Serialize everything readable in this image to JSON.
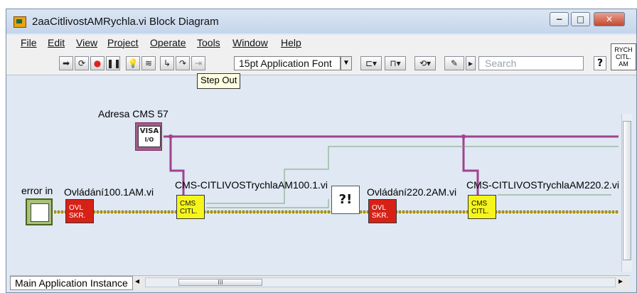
{
  "window": {
    "title": "2aaCitlivostAMRychla.vi Block Diagram",
    "controls": {
      "minimize": "−",
      "maximize": "□",
      "close": "✕"
    }
  },
  "menu": [
    "File",
    "Edit",
    "View",
    "Project",
    "Operate",
    "Tools",
    "Window",
    "Help"
  ],
  "toolbar": {
    "font_select": "15pt Application Font",
    "search_placeholder": "Search",
    "help_label": "?",
    "tooltip": "Step Out",
    "icons": [
      "run-arrow-icon",
      "run-continuously-icon",
      "abort-icon",
      "pause-icon",
      "highlight-execution-icon",
      "retain-wire-values-icon",
      "step-into-icon",
      "step-over-icon",
      "step-out-icon",
      "align-icon",
      "distribute-icon",
      "resize-icon",
      "reorder-icon",
      "cleanup-diagram-icon",
      "search-icon",
      "help-icon"
    ]
  },
  "vi_icon": {
    "lines": [
      "RYCH",
      "CITL.",
      "AM"
    ]
  },
  "diagram": {
    "labels": {
      "adresa": "Adresa CMS 57",
      "error_in": "error in",
      "ovl1": "Ovládání100.1AM.vi",
      "cms1": "CMS-CITLIVOSTrychlaAM100.1.vi",
      "ovl2": "Ovládání220.2AM.vi",
      "cms2": "CMS-CITLIVOSTrychlaAM220.2.vi"
    },
    "blocks": {
      "visa": "VISA",
      "visa_sub": "I/O",
      "red1": [
        "OVL",
        "SKR."
      ],
      "yellow1": [
        "CMS",
        "CITL."
      ],
      "red2": [
        "OVL",
        "SKR."
      ],
      "yellow2": [
        "CMS",
        "CITL."
      ],
      "pencil": "?!"
    },
    "colors": {
      "error_wire": "#7a6a00",
      "visa_wire": "#a2418e",
      "green_wire": "#7aa37a",
      "red_vi": "#d62117",
      "yellow_vi": "#f5f51b"
    }
  },
  "status": {
    "instance": "Main Application Instance",
    "scroll_left": "◂",
    "scroll_right": "▸",
    "scroll_thumb": "III"
  }
}
